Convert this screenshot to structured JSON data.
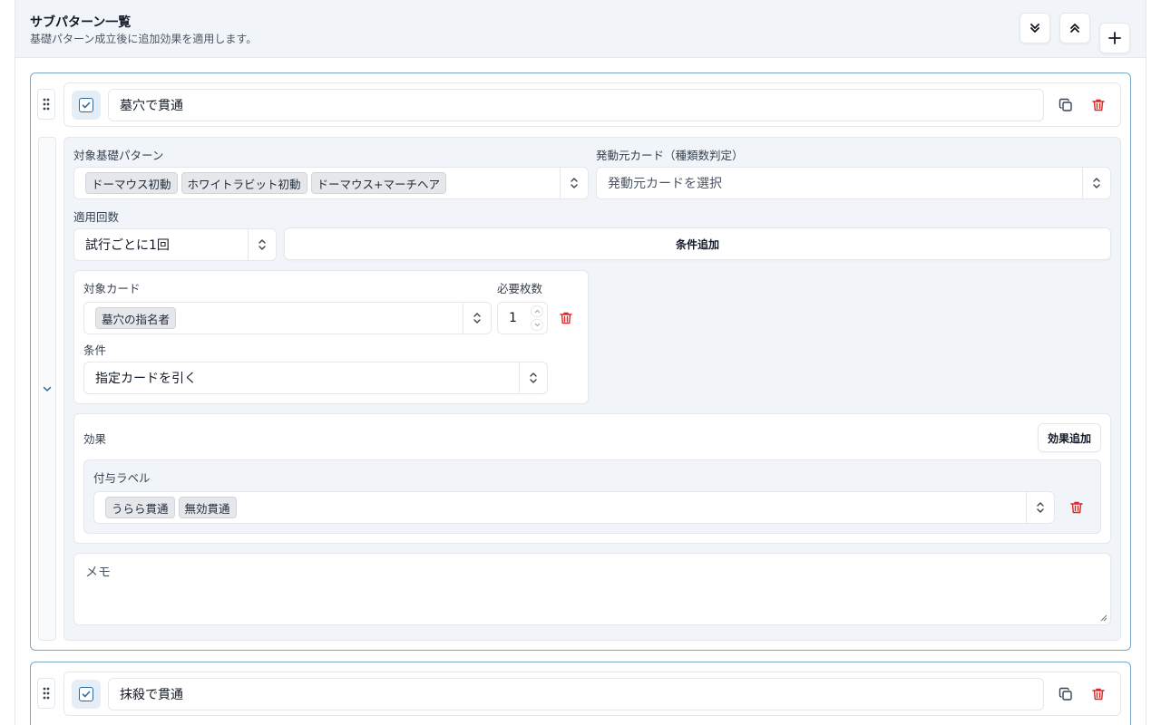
{
  "header": {
    "title": "サブパターン一覧",
    "subtitle": "基礎パターン成立後に追加効果を適用します。"
  },
  "subpatterns": [
    {
      "name": "墓穴で貫通",
      "enabled": true,
      "target_base_pattern": {
        "label": "対象基礎パターン",
        "tags": [
          "ドーマウス初動",
          "ホワイトラビット初動",
          "ドーマウス+マーチヘア"
        ]
      },
      "trigger_card": {
        "label": "発動元カード（種類数判定）",
        "placeholder": "発動元カードを選択"
      },
      "apply_count": {
        "label": "適用回数",
        "value": "試行ごとに1回"
      },
      "add_condition_label": "条件追加",
      "condition": {
        "target_card_label": "対象カード",
        "target_card_tags": [
          "墓穴の指名者"
        ],
        "required_count_label": "必要枚数",
        "required_count": "1",
        "condition_label": "条件",
        "condition_value": "指定カードを引く"
      },
      "effects": {
        "label": "効果",
        "add_label": "効果追加",
        "grant_label": "付与ラベル",
        "grant_tags": [
          "うらら貫通",
          "無効貫通"
        ]
      },
      "memo_placeholder": "メモ"
    },
    {
      "name": "抹殺で貫通",
      "enabled": true
    }
  ],
  "colors": {
    "accent": "#2a6a9e",
    "card_border": "#7aa7c7",
    "danger": "#dc2626",
    "header_bg": "#f1f5f9"
  }
}
